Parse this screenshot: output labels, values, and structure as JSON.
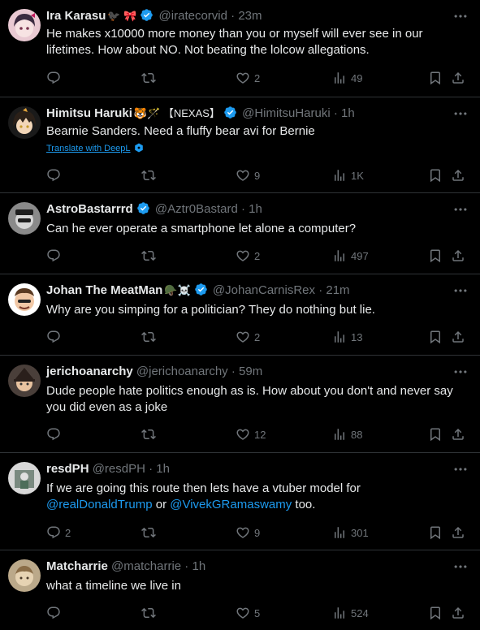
{
  "posts": [
    {
      "name": "Ira Karasu",
      "emoji": "🐦‍⬛ 🎀",
      "verified": true,
      "handle": "@iratecorvid",
      "time": "23m",
      "text": "He makes x10000 more money than you or myself will ever see in our lifetimes. How about NO. Not beating the lolcow allegations.",
      "replies": "",
      "likes": "2",
      "views": "49"
    },
    {
      "name": "Himitsu Haruki",
      "emoji": "🐯🪄 【NEXAS】",
      "verified": true,
      "handle": "@HimitsuHaruki",
      "time": "1h",
      "text": "Bearnie Sanders. Need a fluffy bear avi for Bernie",
      "translate": "Translate with DeepL",
      "replies": "",
      "likes": "9",
      "views": "1K"
    },
    {
      "name": "AstroBastarrrd",
      "emoji": "",
      "verified": true,
      "handle": "@Aztr0Bastard",
      "time": "1h",
      "text": "Can he ever operate a smartphone let alone a computer?",
      "replies": "",
      "likes": "2",
      "views": "497"
    },
    {
      "name": "Johan The MeatMan",
      "emoji": "🪖☠️",
      "verified": true,
      "handle": "@JohanCarnisRex",
      "time": "21m",
      "text": "Why are you simping for a politician? They do nothing but lie.",
      "replies": "",
      "likes": "2",
      "views": "13"
    },
    {
      "name": "jerichoanarchy",
      "emoji": "",
      "verified": false,
      "handle": "@jerichoanarchy",
      "time": "59m",
      "text": "Dude people hate politics enough as is. How about you don't and never say you did even as a joke",
      "replies": "",
      "likes": "12",
      "views": "88"
    },
    {
      "name": "resdPH",
      "emoji": "",
      "verified": false,
      "handle": "@resdPH",
      "time": "1h",
      "text_before": "If we are going this route then lets have a vtuber model for ",
      "mention1": "@realDonaldTrump",
      "text_mid": " or ",
      "mention2": "@VivekGRamaswamy",
      "text_after": " too.",
      "replies": "2",
      "likes": "9",
      "views": "301"
    },
    {
      "name": "Matcharrie",
      "emoji": "",
      "verified": false,
      "handle": "@matcharrie",
      "time": "1h",
      "text": "what a timeline we live in",
      "replies": "",
      "likes": "5",
      "views": "524"
    }
  ],
  "colors": {
    "background": "#000000",
    "text": "#e7e9ea",
    "muted": "#71767b",
    "link": "#1d9bf0",
    "verified": "#1d9bf0",
    "border": "#2f3336"
  },
  "icons": [
    "reply-icon",
    "retweet-icon",
    "like-icon",
    "views-icon",
    "bookmark-icon",
    "share-icon",
    "more-icon",
    "verified-badge-icon",
    "deepl-icon"
  ]
}
